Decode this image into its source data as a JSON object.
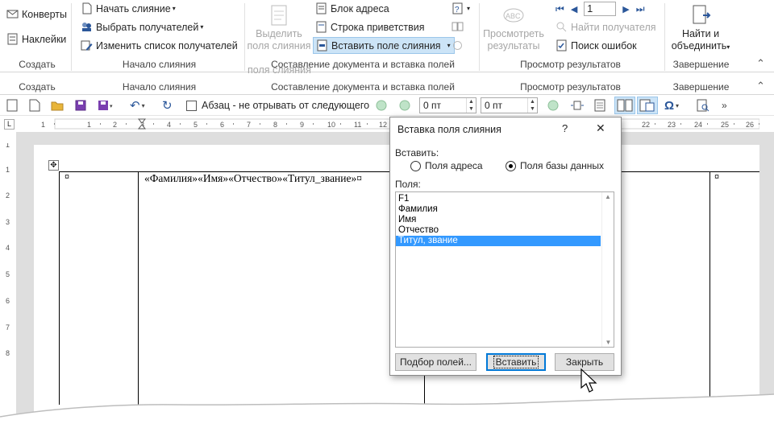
{
  "ribbon": {
    "create_group": {
      "envelopes": "Конверты",
      "labels": "Наклейки",
      "label": "Создать"
    },
    "start_group": {
      "start_merge": "Начать слияние",
      "select_recipients": "Выбрать получателей",
      "edit_list": "Изменить список получателей",
      "label": "Начало слияния"
    },
    "compose_group": {
      "highlight_line1": "Выделить",
      "highlight_line2": "поля слияния",
      "address_block": "Блок адреса",
      "greeting_line": "Строка приветствия",
      "insert_field": "Вставить поле слияния",
      "label": "Составление документа и вставка полей"
    },
    "preview_group": {
      "preview_line1": "Просмотреть",
      "preview_line2": "результаты",
      "abc": "ABC",
      "record_number": "1",
      "find_recipient": "Найти получателя",
      "check_errors": "Поиск ошибок",
      "label": "Просмотр результатов"
    },
    "finish_group": {
      "finish_line1": "Найти и",
      "finish_line2": "объединить",
      "label": "Завершение"
    },
    "dup": {
      "create": "Создать",
      "start": "Начало слияния",
      "compose": "Составление документа и вставка полей",
      "preview": "Просмотр результатов",
      "finish": "Завершение",
      "highlight_frag": "поля слияния",
      "preview_frag": "результаты",
      "finish_frag": "объединить"
    }
  },
  "toolbar": {
    "keep_with_next": "Абзац - не отрывать от следующего",
    "spacing_before": "0 пт",
    "spacing_after": "0 пт"
  },
  "ruler": {
    "h_ticks": [
      "1",
      "1",
      "2",
      "3",
      "4",
      "5",
      "6",
      "7",
      "8",
      "9",
      "10",
      "11",
      "12",
      "22",
      "23",
      "24",
      "25",
      "26"
    ],
    "v_ticks": [
      "1",
      "1",
      "2",
      "3",
      "4",
      "5",
      "6",
      "7",
      "8"
    ]
  },
  "document": {
    "cell_mark_1": "¤",
    "merge_fields": "«Фамилия»«Имя»«Отчество»«Титул_звание»¤",
    "cell_mark_2": "¤"
  },
  "dialog": {
    "title": "Вставка поля слияния",
    "help": "?",
    "close": "✕",
    "insert_label": "Вставить:",
    "radio_address": "Поля адреса",
    "radio_database": "Поля базы данных",
    "fields_label": "Поля:",
    "fields": [
      "F1",
      "Фамилия",
      "Имя",
      "Отчество",
      "Титул, звание"
    ],
    "selected_index": 4,
    "match_fields_button": "Подбор полей...",
    "insert_button": "Вставить",
    "close_button": "Закрыть"
  },
  "colors": {
    "accent": "#2b579a",
    "selection": "#3399ff",
    "selected_button": "#cce4f7"
  }
}
